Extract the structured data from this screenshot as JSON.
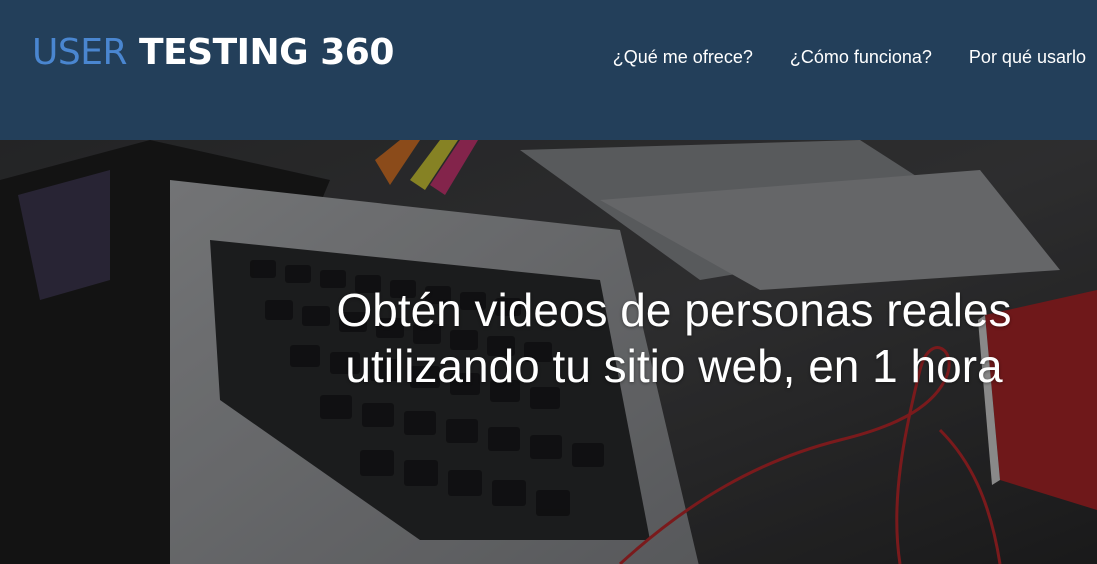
{
  "brand": {
    "part1": "USER",
    "part2": "TESTING 360"
  },
  "nav": {
    "items": [
      {
        "label": "¿Qué me ofrece?"
      },
      {
        "label": "¿Cómo funciona?"
      },
      {
        "label": "Por qué usarlo"
      }
    ]
  },
  "hero": {
    "title": "Obtén videos de personas reales utilizando tu sitio web, en 1 hora"
  },
  "colors": {
    "header_bg": "#233f5a",
    "logo_accent": "#4a86d0",
    "text": "#ffffff"
  }
}
